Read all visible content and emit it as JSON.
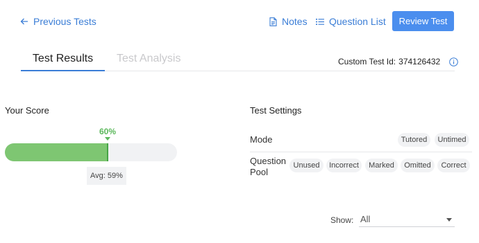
{
  "nav": {
    "previous_tests": "Previous Tests",
    "notes": "Notes",
    "question_list": "Question List",
    "review_button": "Review Test"
  },
  "tabs": [
    {
      "label": "Test Results",
      "active": true
    },
    {
      "label": "Test Analysis",
      "active": false
    }
  ],
  "custom_test_id": {
    "label": "Custom Test Id:",
    "value": "374126432"
  },
  "score": {
    "heading": "Your Score",
    "value_label": "60%",
    "percent": 60,
    "avg_label": "Avg: 59%",
    "avg_percent": 59
  },
  "settings": {
    "heading": "Test Settings",
    "mode": {
      "label": "Mode",
      "chips": [
        "Tutored",
        "Untimed"
      ]
    },
    "pool": {
      "label_line1": "Question",
      "label_line2": "Pool",
      "chips": [
        "Unused",
        "Incorrect",
        "Marked",
        "Omitted",
        "Correct"
      ]
    }
  },
  "filter": {
    "label": "Show:",
    "value": "All"
  },
  "colors": {
    "accent": "#3a7dd6",
    "button": "#4b8eee",
    "score_bar": "#7ec672",
    "score_text": "#5cb85c",
    "chip_bg": "#f1f2f4"
  }
}
